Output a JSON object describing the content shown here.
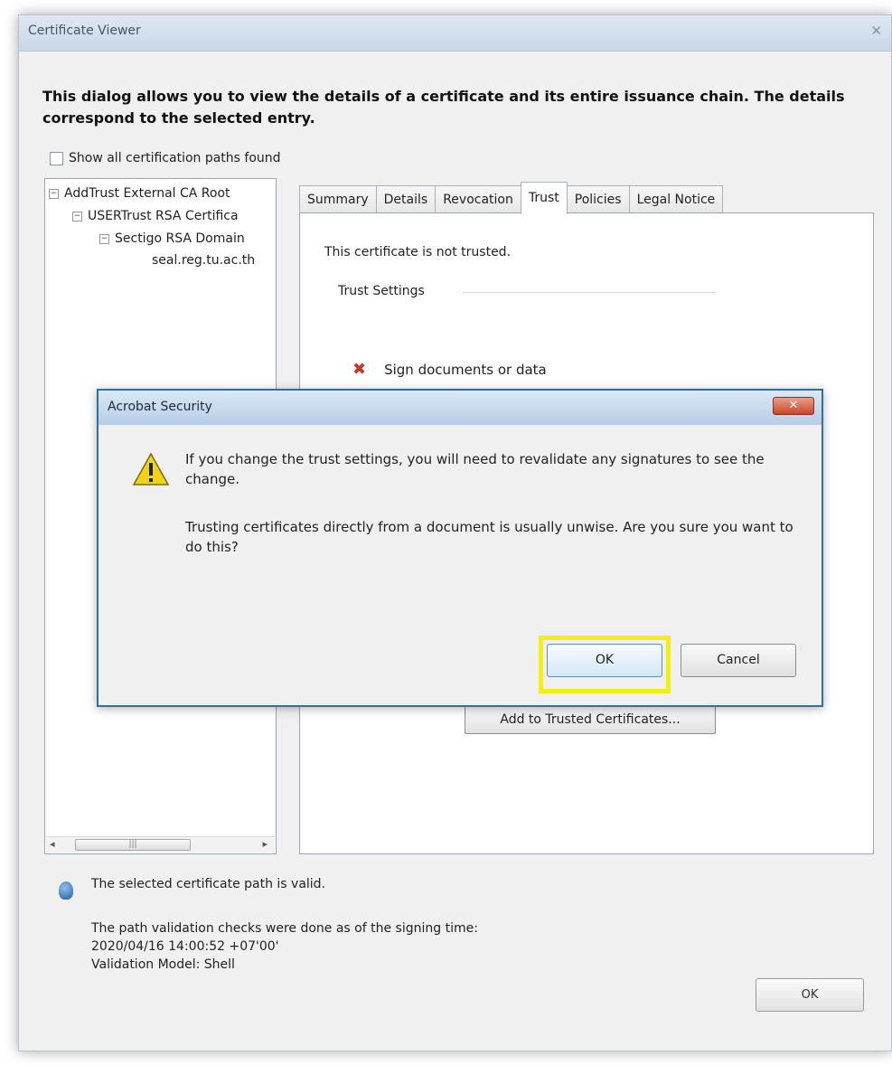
{
  "certificate_viewer": {
    "title": "Certificate Viewer",
    "intro": "This dialog allows you to view the details of a certificate and its entire issuance chain. The details correspond to the selected entry.",
    "show_all_paths_label": "Show all certification paths found",
    "show_all_paths_checked": false,
    "tree": [
      {
        "label": "AddTrust External CA Root",
        "expander": "−"
      },
      {
        "label": "USERTrust RSA Certifica",
        "expander": "−"
      },
      {
        "label": "Sectigo RSA Domain",
        "expander": "−"
      },
      {
        "label": "seal.reg.tu.ac.th",
        "expander": ""
      }
    ],
    "tabs": [
      {
        "label": "Summary"
      },
      {
        "label": "Details"
      },
      {
        "label": "Revocation"
      },
      {
        "label": "Trust"
      },
      {
        "label": "Policies"
      },
      {
        "label": "Legal Notice"
      }
    ],
    "active_tab": "Trust",
    "trust": {
      "status_text": "This certificate is not trusted.",
      "settings_label": "Trust Settings",
      "items": [
        {
          "label": "Sign documents or data",
          "allowed": false,
          "icon": "x-icon"
        }
      ],
      "add_trusted_label": "Add to Trusted Certificates..."
    },
    "status": {
      "valid_text": "The selected certificate path is valid.",
      "checks_text": "The path validation checks were done as of the signing time:",
      "timestamp": "2020/04/16 14:00:52 +07'00'",
      "validation_model": "Validation Model: Shell"
    },
    "ok_label": "OK",
    "close_glyph": "✕"
  },
  "security_dialog": {
    "title": "Acrobat Security",
    "close_glyph": "✕",
    "message_1": "If you change the trust settings, you will need to revalidate any signatures to see the change.",
    "message_2": "Trusting certificates directly from a document is usually unwise. Are you sure you want to do this?",
    "ok_label": "OK",
    "cancel_label": "Cancel",
    "highlight_color": "#f2ee16"
  },
  "colors": {
    "modal_border": "#2e6fa6",
    "close_button": "#c8472a",
    "not_allowed": "#c0392b"
  }
}
